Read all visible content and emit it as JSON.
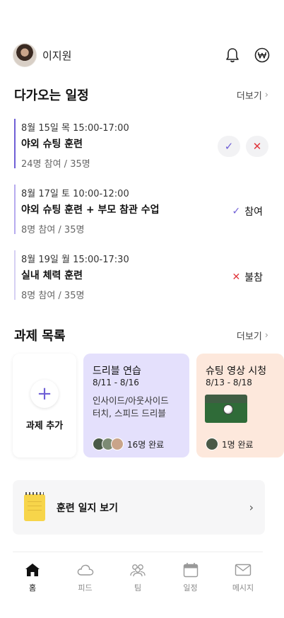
{
  "header": {
    "username": "이지원",
    "icons": [
      "bell-icon",
      "won-icon"
    ]
  },
  "upcoming": {
    "title": "다가오는 일정",
    "more": "더보기",
    "events": [
      {
        "date": "8월 15일 목  15:00-17:00",
        "title": "야외 슈팅 훈련",
        "count": "24명 참여 / 35명",
        "bar_color": "#6f5fd6",
        "accept_icon": "✓",
        "decline_icon": "✕"
      },
      {
        "date": "8월 17일 토  10:00-12:00",
        "title": "야외 슈팅 훈련 + 부모 참관 수업",
        "count": "8명 참여 / 35명",
        "bar_color": "#b7abef",
        "status_icon": "✓",
        "status": "참여"
      },
      {
        "date": "8월 19일 월  15:00-17:30",
        "title": "실내 체력 훈련",
        "count": "8명 참여 / 35명",
        "bar_color": "#d6d0f3",
        "status_icon": "✕",
        "status": "불참"
      }
    ]
  },
  "tasks": {
    "title": "과제 목록",
    "more": "더보기",
    "add_label": "과제 추가",
    "add_icon": "+",
    "cards": [
      {
        "title": "드리블 연습",
        "date": "8/11 - 8/16",
        "desc_line1": "인사이드/아웃사이드",
        "desc_line2": "터치, 스피드 드리블",
        "done": "16명 완료",
        "bg": "#e4e0fc"
      },
      {
        "title": "슈팅 영상 시청",
        "date": "8/13 - 8/18",
        "done": "1명 완료",
        "bg": "#fde8dc"
      }
    ]
  },
  "journal": {
    "label": "훈련 일지 보기"
  },
  "nav": {
    "items": [
      {
        "label": "홈",
        "icon": "home-icon",
        "active": true
      },
      {
        "label": "피드",
        "icon": "cloud-icon"
      },
      {
        "label": "팀",
        "icon": "team-icon"
      },
      {
        "label": "일정",
        "icon": "calendar-icon"
      },
      {
        "label": "메시지",
        "icon": "mail-icon"
      }
    ]
  },
  "colors": {
    "accent": "#6f5fd6",
    "decline": "#e0353b"
  }
}
